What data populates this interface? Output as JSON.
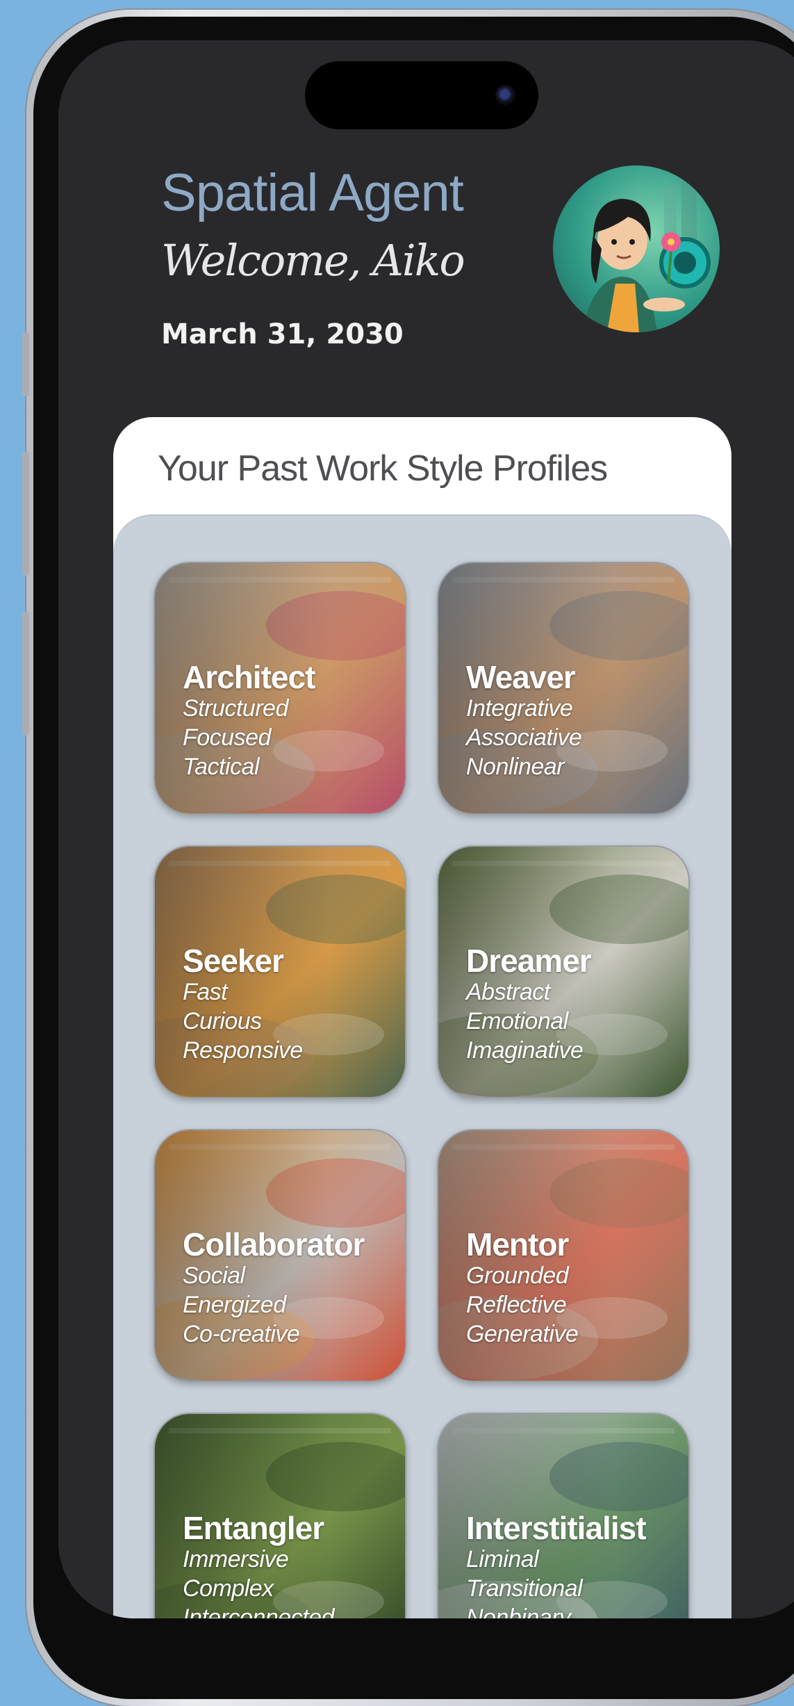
{
  "app": {
    "title": "Spatial Agent",
    "welcome": "Welcome, Aiko",
    "date": "March 31, 2030"
  },
  "avatar": {
    "icon": "user-avatar-illustration"
  },
  "panel": {
    "title": "Your Past Work Style Profiles"
  },
  "profiles": [
    {
      "name": "Architect",
      "traits": [
        "Structured",
        "Focused",
        "Tactical"
      ],
      "palette": [
        "#b9b2a8",
        "#d7a16b",
        "#c0516f"
      ]
    },
    {
      "name": "Weaver",
      "traits": [
        "Integrative",
        "Associative",
        "Nonlinear"
      ],
      "palette": [
        "#9aa3ad",
        "#c79a73",
        "#6c7783"
      ]
    },
    {
      "name": "Seeker",
      "traits": [
        "Fast",
        "Curious",
        "Responsive"
      ],
      "palette": [
        "#b08a62",
        "#e2a24b",
        "#4f6a52"
      ]
    },
    {
      "name": "Dreamer",
      "traits": [
        "Abstract",
        "Emotional",
        "Imaginative"
      ],
      "palette": [
        "#6b7e4c",
        "#d8d6cc",
        "#3f5a32"
      ]
    },
    {
      "name": "Collaborator",
      "traits": [
        "Social",
        "Energized",
        "Co-creative"
      ],
      "palette": [
        "#e9a04a",
        "#c8c2bd",
        "#d9543a"
      ]
    },
    {
      "name": "Mentor",
      "traits": [
        "Grounded",
        "Reflective",
        "Generative"
      ],
      "palette": [
        "#c9b09b",
        "#e07a64",
        "#9a7a5f"
      ]
    },
    {
      "name": "Entangler",
      "traits": [
        "Immersive",
        "Complex",
        "Interconnected"
      ],
      "palette": [
        "#4f6b3a",
        "#7d9a4d",
        "#2f4426"
      ]
    },
    {
      "name": "Interstitialist",
      "traits": [
        "Liminal",
        "Transitional",
        "Nonbinary"
      ],
      "palette": [
        "#d5d9dc",
        "#6e9a6b",
        "#3b5d66"
      ]
    }
  ]
}
